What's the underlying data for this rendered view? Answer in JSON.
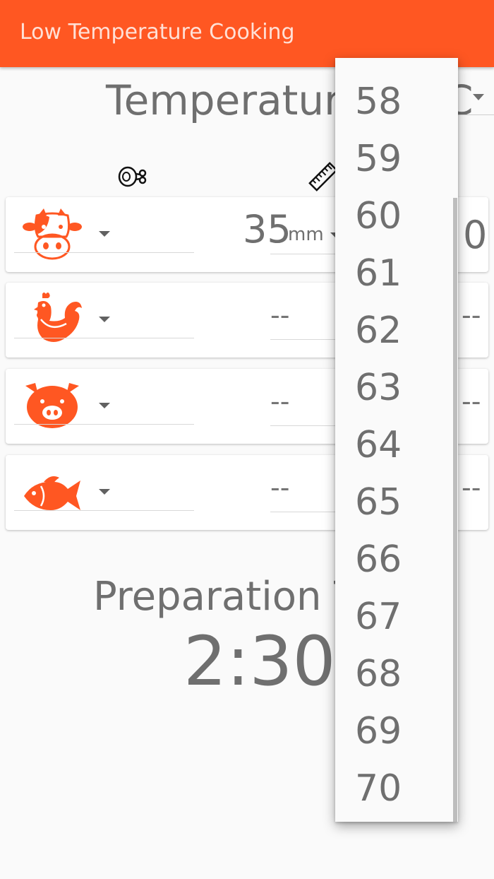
{
  "app": {
    "title": "Low Temperature Cooking",
    "accent_color": "#ff5722"
  },
  "temperature": {
    "label": "Temperature",
    "unit_partial": "C"
  },
  "columns": {
    "meat_icon": "meat-drumstick-icon",
    "thickness_icon": "ruler-icon"
  },
  "rows": [
    {
      "animal_icon": "cow-icon",
      "thickness": "35",
      "thickness_unit": "mm",
      "right_value": "0"
    },
    {
      "animal_icon": "chicken-icon",
      "thickness": "--",
      "right_value": "--"
    },
    {
      "animal_icon": "pig-icon",
      "thickness": "--",
      "right_value": "--"
    },
    {
      "animal_icon": "fish-icon",
      "thickness": "--",
      "right_value": "--"
    }
  ],
  "preparation": {
    "label": "Preparation T",
    "time": "2:30"
  },
  "dropdown": {
    "options": [
      "58",
      "59",
      "60",
      "61",
      "62",
      "63",
      "64",
      "65",
      "66",
      "67",
      "68",
      "69",
      "70"
    ]
  }
}
